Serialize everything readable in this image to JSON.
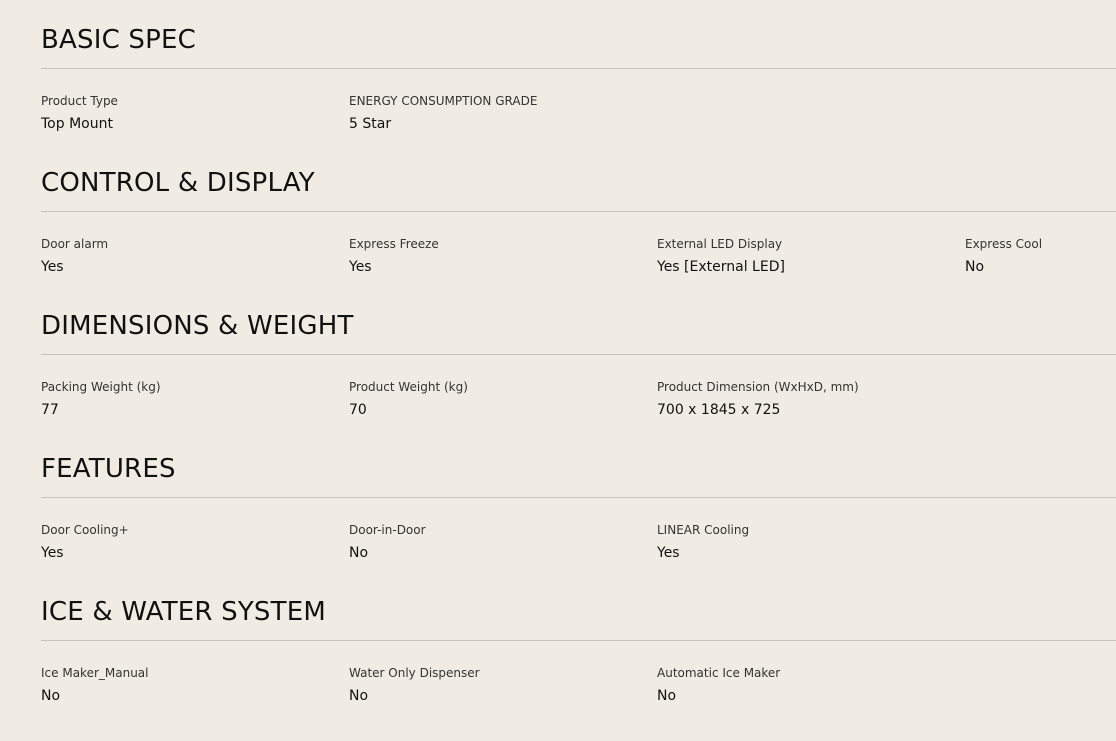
{
  "sections": [
    {
      "title": "BASIC SPEC",
      "items": [
        {
          "label": "Product Type",
          "value": "Top Mount"
        },
        {
          "label": "ENERGY CONSUMPTION GRADE",
          "value": "5 Star"
        }
      ]
    },
    {
      "title": "CONTROL & DISPLAY",
      "items": [
        {
          "label": "Door alarm",
          "value": "Yes"
        },
        {
          "label": "Express Freeze",
          "value": "Yes"
        },
        {
          "label": "External LED Display",
          "value": "Yes [External LED]"
        },
        {
          "label": "Express Cool",
          "value": "No"
        }
      ]
    },
    {
      "title": "DIMENSIONS & WEIGHT",
      "items": [
        {
          "label": "Packing Weight (kg)",
          "value": "77"
        },
        {
          "label": "Product Weight (kg)",
          "value": "70"
        },
        {
          "label": "Product Dimension (WxHxD, mm)",
          "value": "700 x 1845 x 725"
        }
      ]
    },
    {
      "title": "FEATURES",
      "items": [
        {
          "label": "Door Cooling+",
          "value": "Yes"
        },
        {
          "label": "Door-in-Door",
          "value": "No"
        },
        {
          "label": "LINEAR Cooling",
          "value": "Yes"
        }
      ]
    },
    {
      "title": "ICE & WATER SYSTEM",
      "items": [
        {
          "label": "Ice Maker_Manual",
          "value": "No"
        },
        {
          "label": "Water Only Dispenser",
          "value": "No"
        },
        {
          "label": "Automatic Ice Maker",
          "value": "No"
        }
      ]
    }
  ]
}
